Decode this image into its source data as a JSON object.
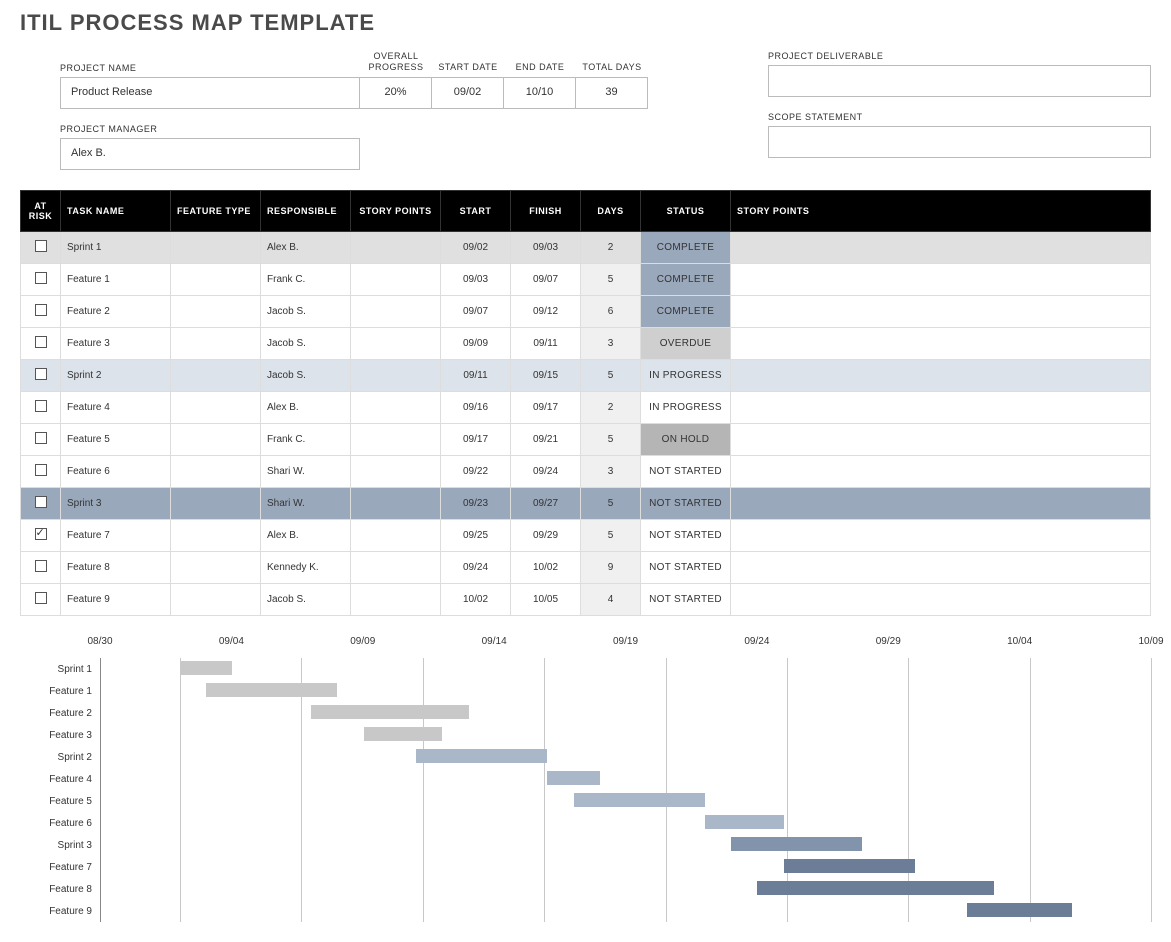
{
  "title": "ITIL PROCESS MAP TEMPLATE",
  "summary": {
    "project_name_label": "PROJECT NAME",
    "project_name": "Product Release",
    "progress_label": "OVERALL PROGRESS",
    "progress": "20%",
    "start_label": "START DATE",
    "start": "09/02",
    "end_label": "END DATE",
    "end": "10/10",
    "days_label": "TOTAL DAYS",
    "days": "39",
    "manager_label": "PROJECT MANAGER",
    "manager": "Alex B.",
    "deliverable_label": "PROJECT DELIVERABLE",
    "deliverable": "",
    "scope_label": "SCOPE STATEMENT",
    "scope": ""
  },
  "columns": {
    "at_risk": "AT RISK",
    "task": "TASK NAME",
    "feature": "FEATURE TYPE",
    "responsible": "RESPONSIBLE",
    "story_points": "STORY POINTS",
    "start": "START",
    "finish": "FINISH",
    "days": "DAYS",
    "status": "STATUS",
    "story_points2": "STORY POINTS"
  },
  "rows": [
    {
      "at_risk": false,
      "task": "Sprint 1",
      "feature": "",
      "responsible": "Alex B.",
      "sp": "",
      "start": "09/02",
      "finish": "09/03",
      "days": "2",
      "status": "COMPLETE",
      "row_class": "row-sprint1"
    },
    {
      "at_risk": false,
      "task": "Feature 1",
      "feature": "",
      "responsible": "Frank C.",
      "sp": "",
      "start": "09/03",
      "finish": "09/07",
      "days": "5",
      "status": "COMPLETE",
      "row_class": ""
    },
    {
      "at_risk": false,
      "task": "Feature 2",
      "feature": "",
      "responsible": "Jacob S.",
      "sp": "",
      "start": "09/07",
      "finish": "09/12",
      "days": "6",
      "status": "COMPLETE",
      "row_class": ""
    },
    {
      "at_risk": false,
      "task": "Feature 3",
      "feature": "",
      "responsible": "Jacob S.",
      "sp": "",
      "start": "09/09",
      "finish": "09/11",
      "days": "3",
      "status": "OVERDUE",
      "row_class": ""
    },
    {
      "at_risk": false,
      "task": "Sprint 2",
      "feature": "",
      "responsible": "Jacob S.",
      "sp": "",
      "start": "09/11",
      "finish": "09/15",
      "days": "5",
      "status": "IN PROGRESS",
      "row_class": "row-sprint2"
    },
    {
      "at_risk": false,
      "task": "Feature 4",
      "feature": "",
      "responsible": "Alex B.",
      "sp": "",
      "start": "09/16",
      "finish": "09/17",
      "days": "2",
      "status": "IN PROGRESS",
      "row_class": ""
    },
    {
      "at_risk": false,
      "task": "Feature 5",
      "feature": "",
      "responsible": "Frank C.",
      "sp": "",
      "start": "09/17",
      "finish": "09/21",
      "days": "5",
      "status": "ON HOLD",
      "row_class": ""
    },
    {
      "at_risk": false,
      "task": "Feature 6",
      "feature": "",
      "responsible": "Shari W.",
      "sp": "",
      "start": "09/22",
      "finish": "09/24",
      "days": "3",
      "status": "NOT STARTED",
      "row_class": ""
    },
    {
      "at_risk": false,
      "task": "Sprint 3",
      "feature": "",
      "responsible": "Shari W.",
      "sp": "",
      "start": "09/23",
      "finish": "09/27",
      "days": "5",
      "status": "NOT STARTED",
      "row_class": "row-sprint3"
    },
    {
      "at_risk": true,
      "task": "Feature 7",
      "feature": "",
      "responsible": "Alex B.",
      "sp": "",
      "start": "09/25",
      "finish": "09/29",
      "days": "5",
      "status": "NOT STARTED",
      "row_class": ""
    },
    {
      "at_risk": false,
      "task": "Feature 8",
      "feature": "",
      "responsible": "Kennedy K.",
      "sp": "",
      "start": "09/24",
      "finish": "10/02",
      "days": "9",
      "status": "NOT STARTED",
      "row_class": ""
    },
    {
      "at_risk": false,
      "task": "Feature 9",
      "feature": "",
      "responsible": "Jacob S.",
      "sp": "",
      "start": "10/02",
      "finish": "10/05",
      "days": "4",
      "status": "NOT STARTED",
      "row_class": ""
    }
  ],
  "chart_data": {
    "type": "bar",
    "title": "",
    "xlabel": "",
    "ylabel": "",
    "x_ticks": [
      "08/30",
      "09/04",
      "09/09",
      "09/14",
      "09/19",
      "09/24",
      "09/29",
      "10/04",
      "10/09"
    ],
    "x_range_days": [
      0,
      40
    ],
    "series": [
      {
        "name": "Sprint 1",
        "start_day": 3,
        "duration": 2,
        "color": "grey"
      },
      {
        "name": "Feature 1",
        "start_day": 4,
        "duration": 5,
        "color": "grey"
      },
      {
        "name": "Feature 2",
        "start_day": 8,
        "duration": 6,
        "color": "grey"
      },
      {
        "name": "Feature 3",
        "start_day": 10,
        "duration": 3,
        "color": "grey"
      },
      {
        "name": "Sprint 2",
        "start_day": 12,
        "duration": 5,
        "color": "blue1"
      },
      {
        "name": "Feature 4",
        "start_day": 17,
        "duration": 2,
        "color": "blue1"
      },
      {
        "name": "Feature 5",
        "start_day": 18,
        "duration": 5,
        "color": "blue1"
      },
      {
        "name": "Feature 6",
        "start_day": 23,
        "duration": 3,
        "color": "blue1"
      },
      {
        "name": "Sprint 3",
        "start_day": 24,
        "duration": 5,
        "color": "blue2"
      },
      {
        "name": "Feature 7",
        "start_day": 26,
        "duration": 5,
        "color": "blue3"
      },
      {
        "name": "Feature 8",
        "start_day": 25,
        "duration": 9,
        "color": "blue3"
      },
      {
        "name": "Feature 9",
        "start_day": 33,
        "duration": 4,
        "color": "blue3"
      }
    ]
  }
}
